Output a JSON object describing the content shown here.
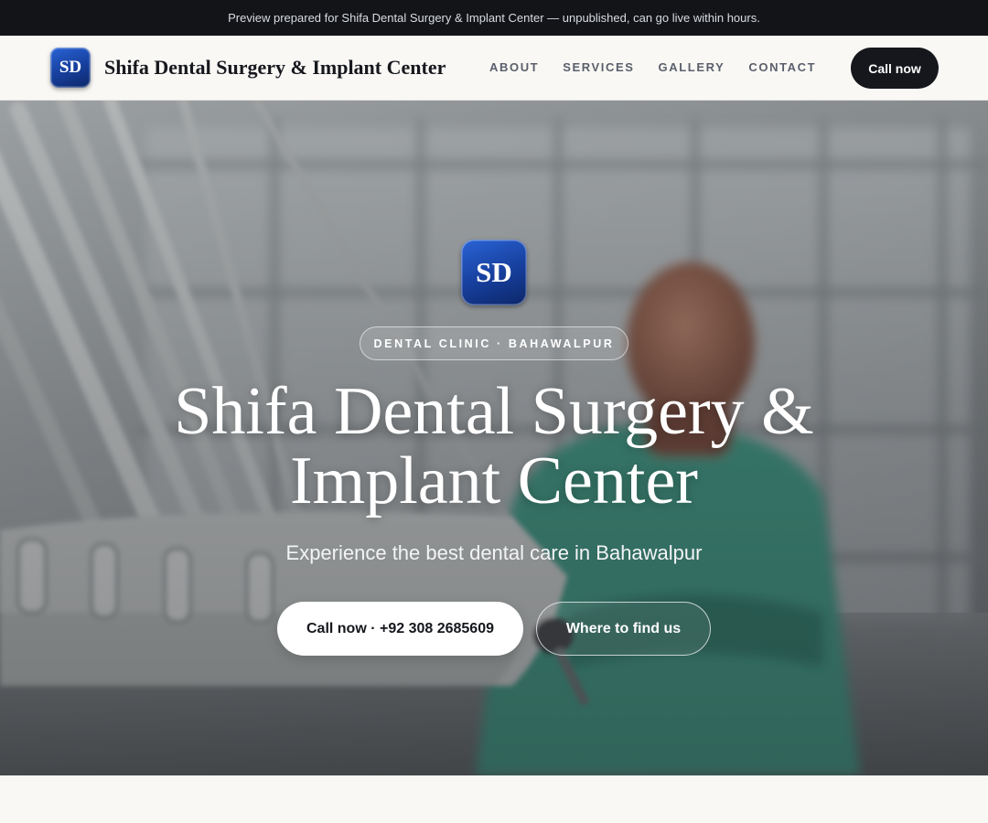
{
  "preview_banner": {
    "text": "Preview prepared for Shifa Dental Surgery & Implant Center — unpublished, can go live within hours."
  },
  "header": {
    "logo_text": "SD",
    "brand_name": "Shifa Dental Surgery & Implant Center",
    "nav": [
      {
        "label": "ABOUT"
      },
      {
        "label": "SERVICES"
      },
      {
        "label": "GALLERY"
      },
      {
        "label": "CONTACT"
      }
    ],
    "cta_label": "Call now"
  },
  "hero": {
    "logo_text": "SD",
    "eyebrow": "DENTAL CLINIC · BAHAWALPUR",
    "title": "Shifa Dental Surgery & Implant Center",
    "subtitle": "Experience the best dental care in Bahawalpur",
    "primary_button": "Call now · +92 308 2685609",
    "secondary_button": "Where to find us",
    "background_image": "dental-clinic-photo"
  },
  "colors": {
    "banner_bg": "#121418",
    "header_bg": "#f9f8f5",
    "accent_dark": "#15171c",
    "logo_blue": "#1f4fb8"
  }
}
